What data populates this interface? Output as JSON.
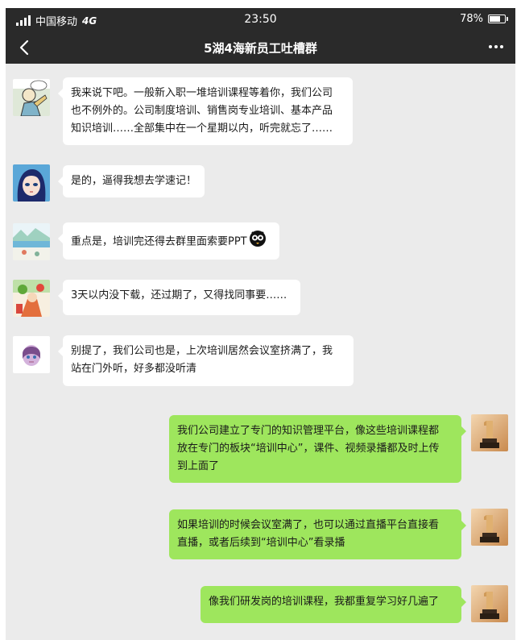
{
  "status_bar": {
    "carrier": "中国移动",
    "network": "4G",
    "time": "23:50",
    "battery": "78%",
    "battery_level": 0.78
  },
  "nav": {
    "title": "5湖4海新员工吐槽群",
    "back_icon": "chevron-left-icon",
    "more_icon": "more-icon"
  },
  "colors": {
    "header_bg": "#2a2a2a",
    "chat_bg": "#ebebeb",
    "incoming_bubble": "#ffffff",
    "outgoing_bubble": "#9ee65d"
  },
  "messages": [
    {
      "side": "in",
      "avatar": "sketch-man-avatar",
      "lines": [
        "我来说下吧。一般新入职一堆培训课程等着你，我们公司",
        "也不例外的。公司制度培训、销售岗专业培训、基本产品",
        "知识培训……全部集中在一个星期以内，听完就忘了……"
      ]
    },
    {
      "side": "in",
      "avatar": "anime-girl-avatar",
      "lines": [
        "是的，逼得我想去学速记！"
      ]
    },
    {
      "side": "in",
      "avatar": "landscape-avatar",
      "lines": [
        "重点是，培训完还得去群里面索要PPT"
      ],
      "emoji": "owl-emoji"
    },
    {
      "side": "in",
      "avatar": "cartoon-avatar",
      "lines": [
        "3天以内没下载，还过期了，又得找同事要……"
      ]
    },
    {
      "side": "in",
      "avatar": "purple-figure-avatar",
      "lines": [
        "别提了，我们公司也是，上次培训居然会议室挤满了，我",
        "站在门外听，好多都没听清"
      ]
    },
    {
      "side": "out",
      "avatar": "trophy-avatar",
      "lines": [
        "我们公司建立了专门的知识管理平台，像这些培训课程都",
        "放在专门的板块“培训中心”，课件、视频录播都及时上传",
        "到上面了"
      ]
    },
    {
      "side": "out",
      "avatar": "trophy-avatar",
      "lines": [
        "如果培训的时候会议室满了，也可以通过直播平台直接看",
        "直播，或者后续到“培训中心”看录播"
      ]
    },
    {
      "side": "out",
      "avatar": "trophy-avatar",
      "lines": [
        "像我们研发岗的培训课程，我都重复学习好几遍了"
      ]
    }
  ]
}
